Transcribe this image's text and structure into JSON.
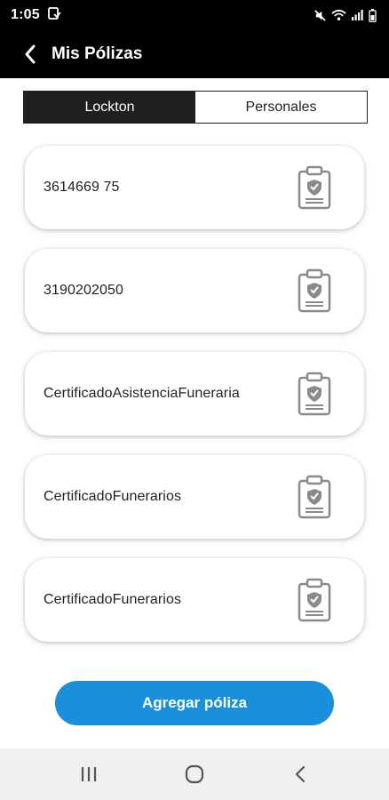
{
  "status_bar": {
    "time": "1:05",
    "icons": [
      "notification-icon",
      "mute-icon",
      "wifi-icon",
      "signal-icon",
      "battery-icon"
    ]
  },
  "app_bar": {
    "title": "Mis Pólizas",
    "back_icon": "chevron-left-icon"
  },
  "tabs": [
    {
      "label": "Lockton",
      "active": true
    },
    {
      "label": "Personales",
      "active": false
    }
  ],
  "policies": [
    {
      "title": "3614669 75"
    },
    {
      "title": "3190202050"
    },
    {
      "title": "CertificadoAsistenciaFuneraria"
    },
    {
      "title": "CertificadoFunerarios"
    },
    {
      "title": "CertificadoFunerarios"
    }
  ],
  "policy_icon": "clipboard-shield-icon",
  "add_button": {
    "label": "Agregar póliza"
  },
  "nav_bar": {
    "icons": [
      "recent-apps-icon",
      "home-icon",
      "back-icon"
    ]
  },
  "colors": {
    "header_bg": "#000000",
    "accent": "#1a8fdc",
    "tab_active_bg": "#1f1f1f",
    "icon_gray": "#8a8a8a"
  }
}
